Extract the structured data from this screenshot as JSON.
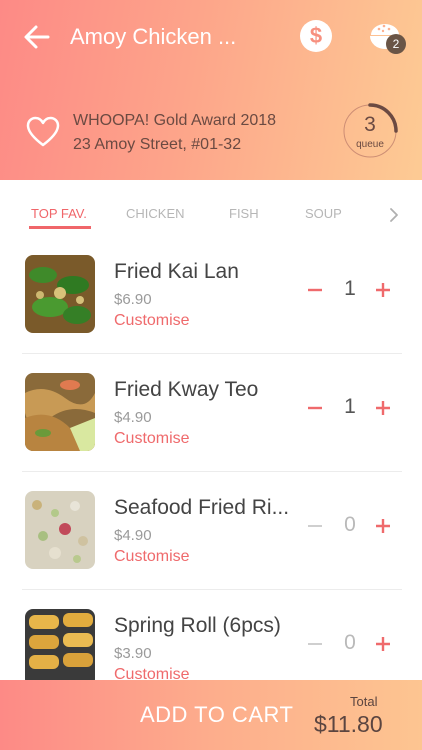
{
  "header": {
    "title": "Amoy Chicken ...",
    "award": "WHOOPA! Gold Award 2018",
    "address": "23 Amoy Street, #01-32",
    "queue_count": "3",
    "queue_label": "queue",
    "cart_badge": "2",
    "currency_symbol": "$"
  },
  "tabs": [
    "TOP FAV.",
    "CHICKEN",
    "FISH",
    "SOUP"
  ],
  "active_tab": "TOP FAV.",
  "items": [
    {
      "name": "Fried Kai Lan",
      "price": "$6.90",
      "action": "Customise",
      "qty": "1"
    },
    {
      "name": "Fried Kway Teo",
      "price": "$4.90",
      "action": "Customise",
      "qty": "1"
    },
    {
      "name": "Seafood Fried Ri...",
      "price": "$4.90",
      "action": "Customise",
      "qty": "0"
    },
    {
      "name": "Spring Roll (6pcs)",
      "price": "$3.90",
      "action": "Customise",
      "qty": "0"
    }
  ],
  "cart": {
    "label": "ADD TO CART",
    "total_label": "Total",
    "total_value": "$11.80"
  },
  "colors": {
    "accent": "#f0666a",
    "header_start": "#fd8a86",
    "header_end": "#fdcb94",
    "text_dark": "#6b4a42"
  },
  "icons": [
    "back-arrow-icon",
    "dollar-icon",
    "bowl-icon",
    "heart-icon",
    "queue-ring-icon",
    "chevron-right-icon",
    "minus-icon",
    "plus-icon"
  ]
}
